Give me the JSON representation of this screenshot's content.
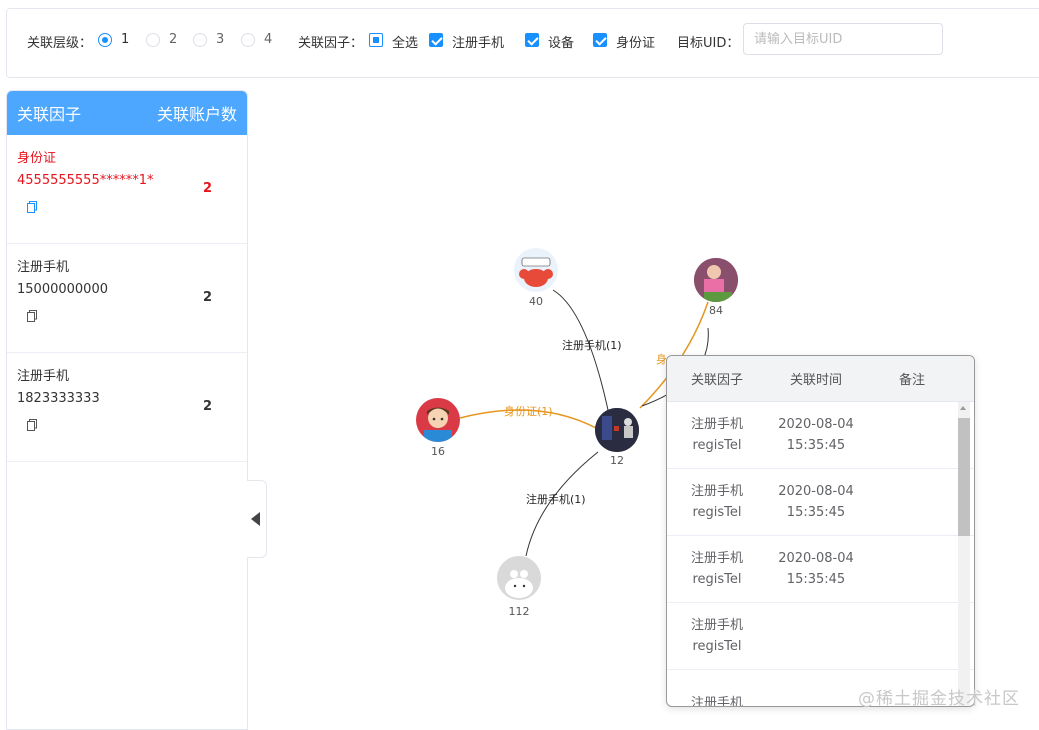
{
  "filter": {
    "level_label": "关联层级：",
    "levels": [
      "1",
      "2",
      "3",
      "4"
    ],
    "selected_level": "1",
    "factor_label": "关联因子：",
    "factors": [
      {
        "label": "全选",
        "state": "indeterminate"
      },
      {
        "label": "注册手机",
        "state": "checked"
      },
      {
        "label": "设备",
        "state": "checked"
      },
      {
        "label": "身份证",
        "state": "checked"
      }
    ],
    "uid_label": "目标UID：",
    "uid_placeholder": "请输入目标UID",
    "uid_value": ""
  },
  "sidebar": {
    "header": {
      "col1": "关联因子",
      "col2": "关联账户数"
    },
    "items": [
      {
        "type": "身份证",
        "value": "4555555555******1*",
        "count": "2",
        "highlight": true
      },
      {
        "type": "注册手机",
        "value": "15000000000",
        "count": "2",
        "highlight": false
      },
      {
        "type": "注册手机",
        "value": "1823333333",
        "count": "2",
        "highlight": false
      }
    ],
    "copy_icon": "copy-icon"
  },
  "graph": {
    "nodes": [
      {
        "id": "12",
        "label": "12",
        "avatar": "dark-night-avatar"
      },
      {
        "id": "40",
        "label": "40",
        "avatar": "cartoon-crab-avatar"
      },
      {
        "id": "84",
        "label": "84",
        "avatar": "photo-person-avatar"
      },
      {
        "id": "16",
        "label": "16",
        "avatar": "cartoon-boy-avatar"
      },
      {
        "id": "112",
        "label": "112",
        "avatar": "default-grey-avatar"
      }
    ],
    "edges": [
      {
        "from": "12",
        "to": "40",
        "label": "注册手机(1)",
        "color": "#333333"
      },
      {
        "from": "12",
        "to": "16",
        "label": "身份证(1)",
        "color": "#e6961e"
      },
      {
        "from": "12",
        "to": "112",
        "label": "注册手机(1)",
        "color": "#333333"
      },
      {
        "from": "12",
        "to": "84",
        "label": "身",
        "color": "#e6961e"
      },
      {
        "from": "12",
        "to": "84",
        "label": "",
        "color": "#333333"
      }
    ]
  },
  "popup": {
    "headers": [
      "关联因子",
      "关联时间",
      "备注"
    ],
    "rows": [
      {
        "factor": "注册手机",
        "code": "regisTel",
        "date": "2020-08-04",
        "time": "15:35:45",
        "note": ""
      },
      {
        "factor": "注册手机",
        "code": "regisTel",
        "date": "2020-08-04",
        "time": "15:35:45",
        "note": ""
      },
      {
        "factor": "注册手机",
        "code": "regisTel",
        "date": "2020-08-04",
        "time": "15:35:45",
        "note": ""
      },
      {
        "factor": "注册手机",
        "code": "regisTel",
        "date": "",
        "time": "",
        "note": ""
      },
      {
        "factor": "注册手机",
        "code": "",
        "date": "",
        "time": "",
        "note": ""
      }
    ]
  },
  "watermark": "@稀土掘金技术社区",
  "colors": {
    "primary": "#1890ff",
    "header_bg": "#4da7ff",
    "highlight": "#e6141e",
    "edge_orange": "#e6961e"
  }
}
